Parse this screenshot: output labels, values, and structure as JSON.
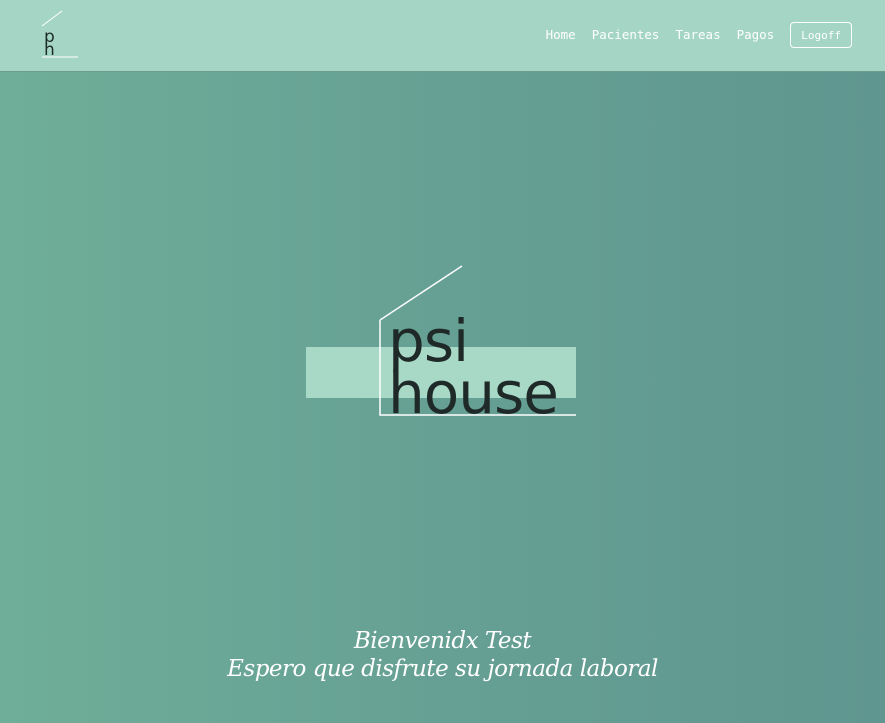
{
  "brand": {
    "logo_text": "ph"
  },
  "nav": {
    "links": [
      "Home",
      "Pacientes",
      "Tareas",
      "Pagos"
    ],
    "logoff_label": "Logoff"
  },
  "hero": {
    "logo_line1": "psi",
    "logo_line2": "house"
  },
  "greeting": {
    "line1": "Bienvenidx Test",
    "line2": "Espero que disfrute su jornada laboral"
  },
  "colors": {
    "navbar": "#a5d6c5",
    "background_left": "#6fae98",
    "background_right": "#5f968f",
    "logo_band": "#a8d8c6",
    "text_light": "#ffffff",
    "logo_text": "#1f2a28"
  }
}
